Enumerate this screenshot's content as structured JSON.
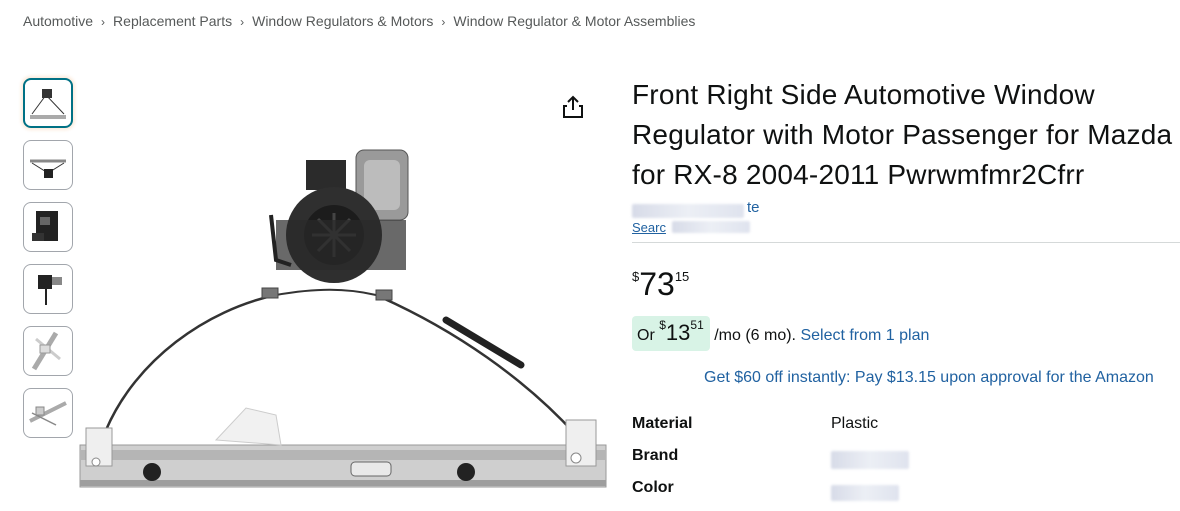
{
  "breadcrumb": [
    "Automotive",
    "Replacement Parts",
    "Window Regulators & Motors",
    "Window Regulator & Motor Assemblies"
  ],
  "breadcrumb_separator": "›",
  "product": {
    "title": "Front Right Side Automotive Window Regulator with Motor Passenger for Mazda for RX-8 2004-2011 Pwrwmfmr2Cfrr",
    "store_link_tail": "te",
    "search_link_text": "Searc"
  },
  "price": {
    "symbol": "$",
    "whole": "73",
    "fraction": "15"
  },
  "monthly": {
    "prefix": "Or ",
    "symbol": "$",
    "whole": "13",
    "fraction": "51",
    "suffix": " /mo (6 mo). ",
    "link": "Select from 1 plan"
  },
  "promo": "Get $60 off instantly: Pay $13.15 upon approval for the Amazon",
  "specs": [
    {
      "label": "Material",
      "value": "Plastic"
    },
    {
      "label": "Brand",
      "value": ""
    },
    {
      "label": "Color",
      "value": ""
    }
  ],
  "icons": {
    "share": "share-icon"
  },
  "colors": {
    "link": "#2162a1",
    "chip_bg": "#d8f3e6",
    "active_thumb_border": "#007185"
  }
}
